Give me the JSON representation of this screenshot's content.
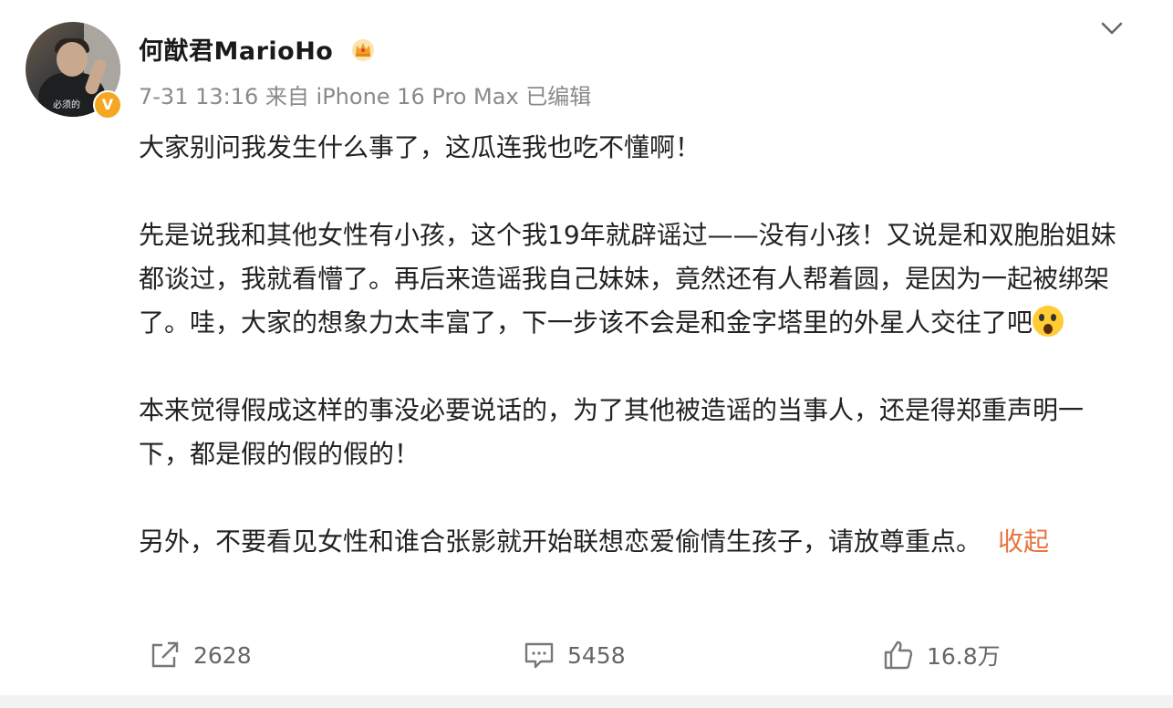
{
  "post": {
    "author": "何猷君MarioHo",
    "avatar_text": "必须的",
    "verified_icon": "verified-v-icon",
    "badge_icon": "crown-icon",
    "time": "7-31 13:16",
    "source": "来自 iPhone 16 Pro Max",
    "edited": "已编辑",
    "menu_icon": "chevron-down-icon",
    "paragraphs": [
      "大家别问我发生什么事了，这瓜连我也吃不懂啊！",
      "先是说我和其他女性有小孩，这个我19年就辟谣过——没有小孩！又说是和双胞胎姐妹都谈过，我就看懵了。再后来造谣我自己妹妹，竟然还有人帮着圆，是因为一起被绑架了。哇，大家的想象力太丰富了，下一步该不会是和金字塔里的外星人交往了吧",
      "本来觉得假成这样的事没必要说话的，为了其他被造谣的当事人，还是得郑重声明一下，都是假的假的假的！",
      "另外，不要看见女性和谁合张影就开始联想恋爱偷情生孩子，请放尊重点。"
    ],
    "emoji": "scream-emoji",
    "collapse_label": "收起"
  },
  "actions": {
    "share": {
      "icon": "share-icon",
      "count": "2628"
    },
    "comment": {
      "icon": "comment-icon",
      "count": "5458"
    },
    "like": {
      "icon": "thumbs-up-icon",
      "count": "16.8万"
    }
  },
  "colors": {
    "accent": "#eb7340",
    "meta": "#8a8a8a",
    "verified": "#f5a623"
  }
}
